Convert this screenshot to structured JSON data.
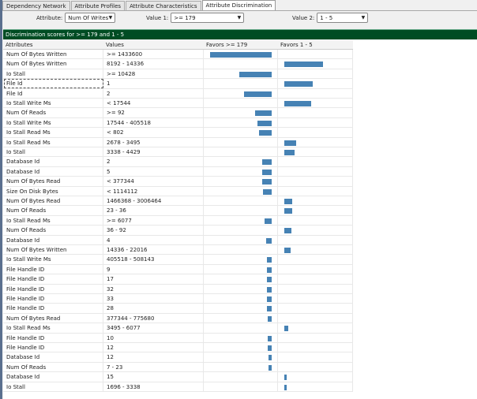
{
  "tabs": [
    {
      "label": "Dependency Network"
    },
    {
      "label": "Attribute Profiles"
    },
    {
      "label": "Attribute Characteristics"
    },
    {
      "label": "Attribute Discrimination",
      "active": true
    }
  ],
  "controls": {
    "attribute_label": "Attribute:",
    "attribute_value": "Num Of Writes",
    "value1_label": "Value 1:",
    "value1_value": ">= 179",
    "value2_label": "Value 2:",
    "value2_value": "1 - 5"
  },
  "banner": "Discrimination scores for >= 179 and 1 - 5",
  "columns": {
    "attributes": "Attributes",
    "values": "Values",
    "favors1": "Favors >= 179",
    "favors2": "Favors 1 - 5"
  },
  "colors": {
    "bar": "#4682b4",
    "banner": "#004c23"
  },
  "score_scale_max": 78,
  "rows": [
    {
      "attribute": "Num Of Bytes Written",
      "value": ">= 1433600",
      "favors": 1,
      "score": 78
    },
    {
      "attribute": "Num Of Bytes Written",
      "value": "8192 - 14336",
      "favors": 2,
      "score": 49
    },
    {
      "attribute": "Io Stall",
      "value": ">= 10428",
      "favors": 1,
      "score": 41
    },
    {
      "attribute": "File Id",
      "value": "1",
      "favors": 2,
      "score": 36,
      "focused": true
    },
    {
      "attribute": "File Id",
      "value": "2",
      "favors": 1,
      "score": 35
    },
    {
      "attribute": "Io Stall Write Ms",
      "value": "< 17544",
      "favors": 2,
      "score": 34
    },
    {
      "attribute": "Num Of Reads",
      "value": ">= 92",
      "favors": 1,
      "score": 21
    },
    {
      "attribute": "Io Stall Write Ms",
      "value": "17544 - 405518",
      "favors": 1,
      "score": 18
    },
    {
      "attribute": "Io Stall Read Ms",
      "value": "< 802",
      "favors": 1,
      "score": 16
    },
    {
      "attribute": "Io Stall Read Ms",
      "value": "2678 - 3495",
      "favors": 2,
      "score": 15
    },
    {
      "attribute": "Io Stall",
      "value": "3338 - 4429",
      "favors": 2,
      "score": 13
    },
    {
      "attribute": "Database Id",
      "value": "2",
      "favors": 1,
      "score": 12
    },
    {
      "attribute": "Database Id",
      "value": "5",
      "favors": 1,
      "score": 12
    },
    {
      "attribute": "Num Of Bytes Read",
      "value": "< 377344",
      "favors": 1,
      "score": 12
    },
    {
      "attribute": "Size On Disk Bytes",
      "value": "< 1114112",
      "favors": 1,
      "score": 11
    },
    {
      "attribute": "Num Of Bytes Read",
      "value": "1466368 - 3006464",
      "favors": 2,
      "score": 10
    },
    {
      "attribute": "Num Of Reads",
      "value": "23 - 36",
      "favors": 2,
      "score": 10
    },
    {
      "attribute": "Io Stall Read Ms",
      "value": ">= 6077",
      "favors": 1,
      "score": 9
    },
    {
      "attribute": "Num Of Reads",
      "value": "36 - 92",
      "favors": 2,
      "score": 9
    },
    {
      "attribute": "Database Id",
      "value": "4",
      "favors": 1,
      "score": 7
    },
    {
      "attribute": "Num Of Bytes Written",
      "value": "14336 - 22016",
      "favors": 2,
      "score": 8
    },
    {
      "attribute": "Io Stall Write Ms",
      "value": "405518 - 508143",
      "favors": 1,
      "score": 6
    },
    {
      "attribute": "File Handle ID",
      "value": "9",
      "favors": 1,
      "score": 6
    },
    {
      "attribute": "File Handle ID",
      "value": "17",
      "favors": 1,
      "score": 6
    },
    {
      "attribute": "File Handle ID",
      "value": "32",
      "favors": 1,
      "score": 6
    },
    {
      "attribute": "File Handle ID",
      "value": "33",
      "favors": 1,
      "score": 6
    },
    {
      "attribute": "File Handle ID",
      "value": "28",
      "favors": 1,
      "score": 6
    },
    {
      "attribute": "Num Of Bytes Read",
      "value": "377344 - 775680",
      "favors": 1,
      "score": 5
    },
    {
      "attribute": "Io Stall Read Ms",
      "value": "3495 - 6077",
      "favors": 2,
      "score": 5
    },
    {
      "attribute": "File Handle ID",
      "value": "10",
      "favors": 1,
      "score": 5
    },
    {
      "attribute": "File Handle ID",
      "value": "12",
      "favors": 1,
      "score": 5
    },
    {
      "attribute": "Database Id",
      "value": "12",
      "favors": 1,
      "score": 4
    },
    {
      "attribute": "Num Of Reads",
      "value": "7 - 23",
      "favors": 1,
      "score": 4
    },
    {
      "attribute": "Database Id",
      "value": "15",
      "favors": 2,
      "score": 3
    },
    {
      "attribute": "Io Stall",
      "value": "1696 - 3338",
      "favors": 2,
      "score": 3
    }
  ]
}
